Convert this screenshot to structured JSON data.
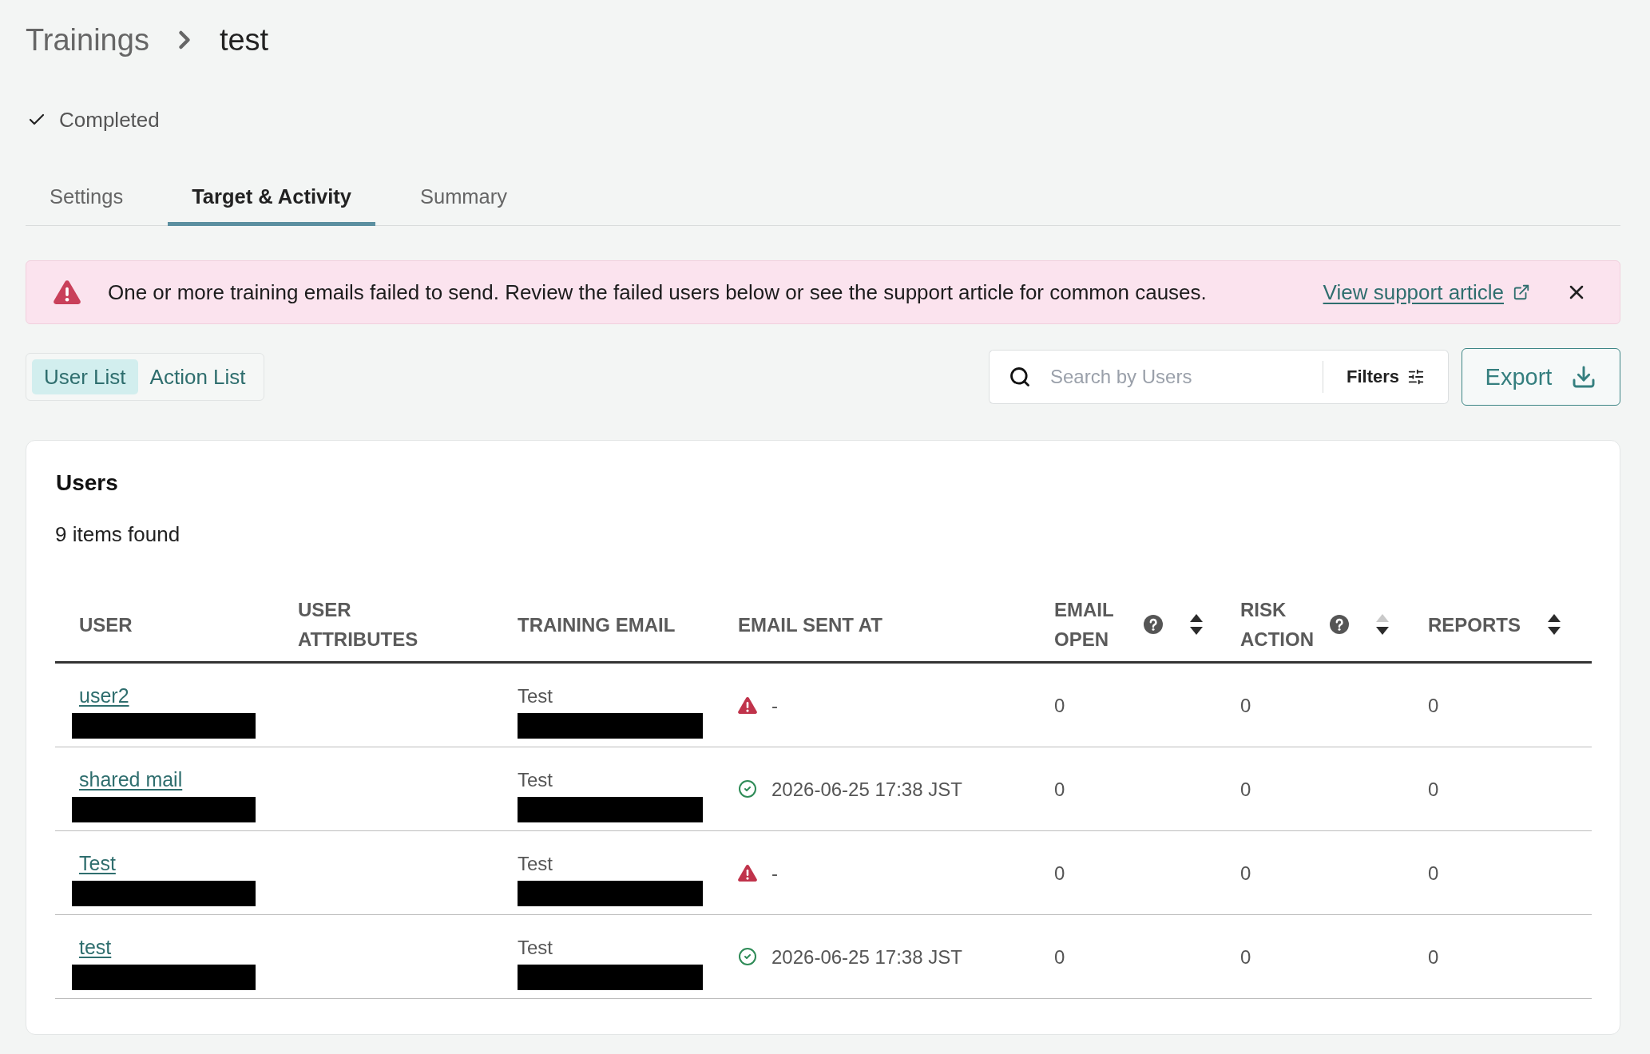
{
  "breadcrumb": {
    "parent": "Trainings",
    "current": "test"
  },
  "status": {
    "kind": "completed",
    "label": "Completed"
  },
  "tabs": [
    {
      "label": "Settings",
      "selected": false
    },
    {
      "label": "Target & Activity",
      "selected": true
    },
    {
      "label": "Summary",
      "selected": false
    }
  ],
  "alert": {
    "kind": "error",
    "message": "One or more training emails failed to send. Review the failed users below or see the support article for common causes.",
    "link": "View support article"
  },
  "views": [
    {
      "label": "User List",
      "selected": true
    },
    {
      "label": "Action List",
      "selected": false
    }
  ],
  "search": {
    "placeholder": "Search by Users"
  },
  "filters_button": "Filters",
  "export_button": "Export",
  "users_panel": {
    "title": "Users",
    "count": "9 items found",
    "table": {
      "columns": [
        {
          "label": "USER"
        },
        {
          "label": "USER ATTRIBUTES"
        },
        {
          "label": "TRAINING EMAIL"
        },
        {
          "label": "EMAIL SENT AT"
        },
        {
          "label": "EMAIL OPEN",
          "help": true,
          "sortable": true,
          "sorted_descending": false
        },
        {
          "label": "RISK ACTION",
          "help": true,
          "sortable": true,
          "sorted_descending": true
        },
        {
          "label": "REPORTS",
          "sortable": true,
          "sorted_descending": false
        }
      ],
      "rows": [
        {
          "user": "user2",
          "redacted": true,
          "training_email": "Test",
          "failed": true,
          "email_sent_at": "-",
          "email_open": "0",
          "risk_action": "0",
          "reports": "0"
        },
        {
          "user": "shared mail",
          "redacted": true,
          "training_email": "Test",
          "failed": false,
          "email_sent_at": "2026-06-25 17:38 JST",
          "email_open": "0",
          "risk_action": "0",
          "reports": "0"
        },
        {
          "user": "Test",
          "redacted": true,
          "training_email": "Test",
          "failed": true,
          "email_sent_at": "-",
          "email_open": "0",
          "risk_action": "0",
          "reports": "0"
        },
        {
          "user": "test",
          "redacted": true,
          "training_email": "Test",
          "failed": false,
          "email_sent_at": "2026-06-25 17:38 JST",
          "email_open": "0",
          "risk_action": "0",
          "reports": "0"
        }
      ]
    }
  }
}
